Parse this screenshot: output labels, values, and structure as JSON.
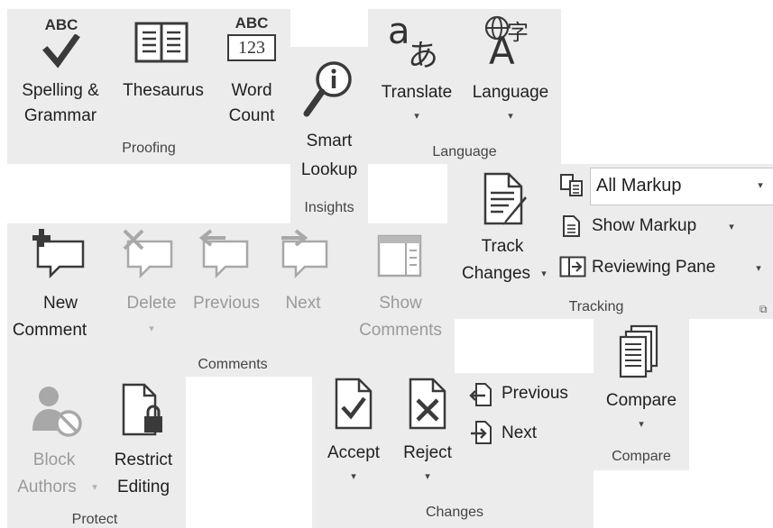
{
  "proofing": {
    "spelling_line1": "Spelling &",
    "spelling_line2": "Grammar",
    "spelling_icon_text": "ABC",
    "thesaurus": "Thesaurus",
    "word_count_line1": "Word",
    "word_count_line2": "Count",
    "word_count_icon_top": "ABC",
    "word_count_icon_bottom": "123",
    "group_label": "Proofing"
  },
  "insights": {
    "smart_lookup_line1": "Smart",
    "smart_lookup_line2": "Lookup",
    "group_label": "Insights"
  },
  "language": {
    "translate": "Translate",
    "language": "Language",
    "group_label": "Language"
  },
  "tracking": {
    "track_changes_line1": "Track",
    "track_changes_line2": "Changes",
    "markup_select_value": "All Markup",
    "show_markup": "Show Markup",
    "reviewing_pane": "Reviewing Pane",
    "group_label": "Tracking"
  },
  "comments": {
    "new_line1": "New",
    "new_line2": "Comment",
    "delete": "Delete",
    "previous": "Previous",
    "next": "Next",
    "show_line1": "Show",
    "show_line2": "Comments",
    "group_label": "Comments"
  },
  "protect": {
    "block_line1": "Block",
    "block_line2": "Authors",
    "restrict_line1": "Restrict",
    "restrict_line2": "Editing",
    "group_label": "Protect"
  },
  "changes": {
    "accept": "Accept",
    "reject": "Reject",
    "previous": "Previous",
    "next": "Next",
    "group_label": "Changes"
  },
  "compare": {
    "compare": "Compare",
    "group_label": "Compare"
  },
  "icons": {
    "caret": "▾",
    "dialog_launcher": "⧉",
    "check": "✔",
    "language_glyph_a": "a",
    "language_glyph_b": "あ",
    "language_glyph_c": "字",
    "language_glyph_d": "A"
  }
}
